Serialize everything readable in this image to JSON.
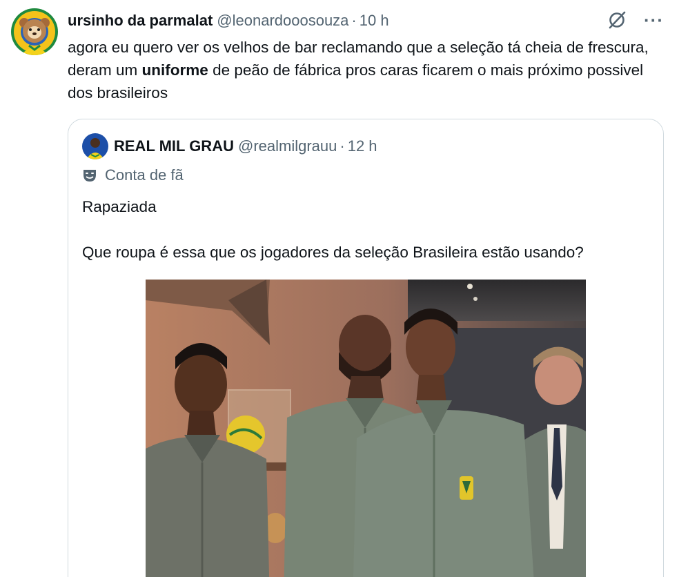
{
  "tweet": {
    "display_name": "ursinho da parmalat",
    "handle": "@leonardooosouza",
    "separator": "·",
    "time": "10 h",
    "text_before": "agora eu quero ver os velhos de bar reclamando que a seleção tá cheia de frescura, deram um ",
    "text_bold": "uniforme",
    "text_after": " de peão de fábrica pros caras ficarem o mais próximo possivel dos brasileiros"
  },
  "icons": {
    "avatar": "bear-avatar",
    "grok": "grok-icon",
    "more": "more-icon",
    "fan_label": "theater-mask-icon"
  },
  "more_glyph": "···",
  "quote": {
    "display_name": "REAL MIL GRAU",
    "handle": "@realmilgrauu",
    "separator": "·",
    "time": "12 h",
    "label": "Conta de fã",
    "text_line1": "Rapaziada",
    "text_line2": "Que roupa é essa que os jogadores da seleção Brasileira estão usando?"
  },
  "colors": {
    "text": "#0f1419",
    "secondary": "#536471",
    "border": "#cfd9de",
    "uniform": "#7c8a7c"
  }
}
